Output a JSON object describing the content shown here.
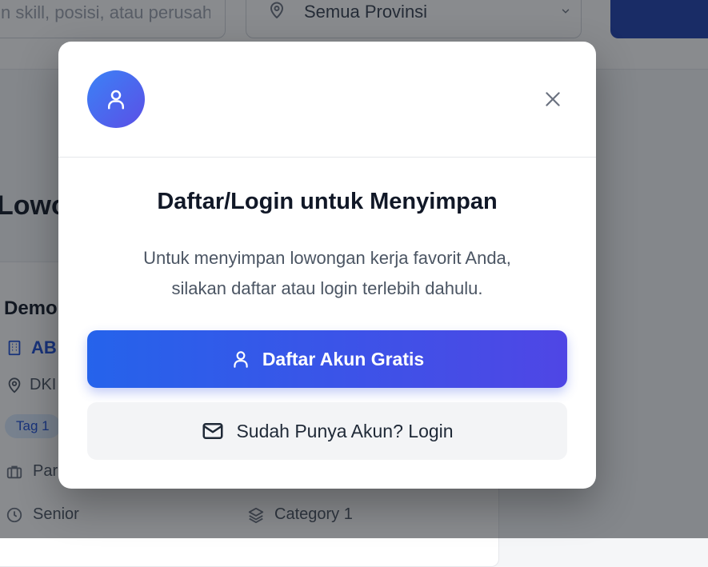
{
  "background": {
    "search_placeholder": "n skill, posisi, atau perusahaan",
    "province_value": "Semua Provinsi",
    "page_heading": "Lowo",
    "job": {
      "title": "Demo",
      "company": "AB",
      "location": "DKI",
      "tag": "Tag 1",
      "employment": "Par",
      "level": "Senior",
      "category": "Category 1"
    }
  },
  "modal": {
    "title": "Daftar/Login untuk Menyimpan",
    "message_line1": "Untuk menyimpan lowongan kerja favorit Anda,",
    "message_line2": "silakan daftar atau login terlebih dahulu.",
    "register_label": "Daftar Akun Gratis",
    "login_label": "Sudah Punya Akun? Login",
    "icons": {
      "avatar": "user-icon",
      "close": "close-icon",
      "register": "user-icon",
      "login": "mail-icon"
    },
    "colors": {
      "gradient_start": "#2563eb",
      "gradient_end": "#4f46e5",
      "title": "#111827",
      "message": "#4b5563"
    }
  }
}
